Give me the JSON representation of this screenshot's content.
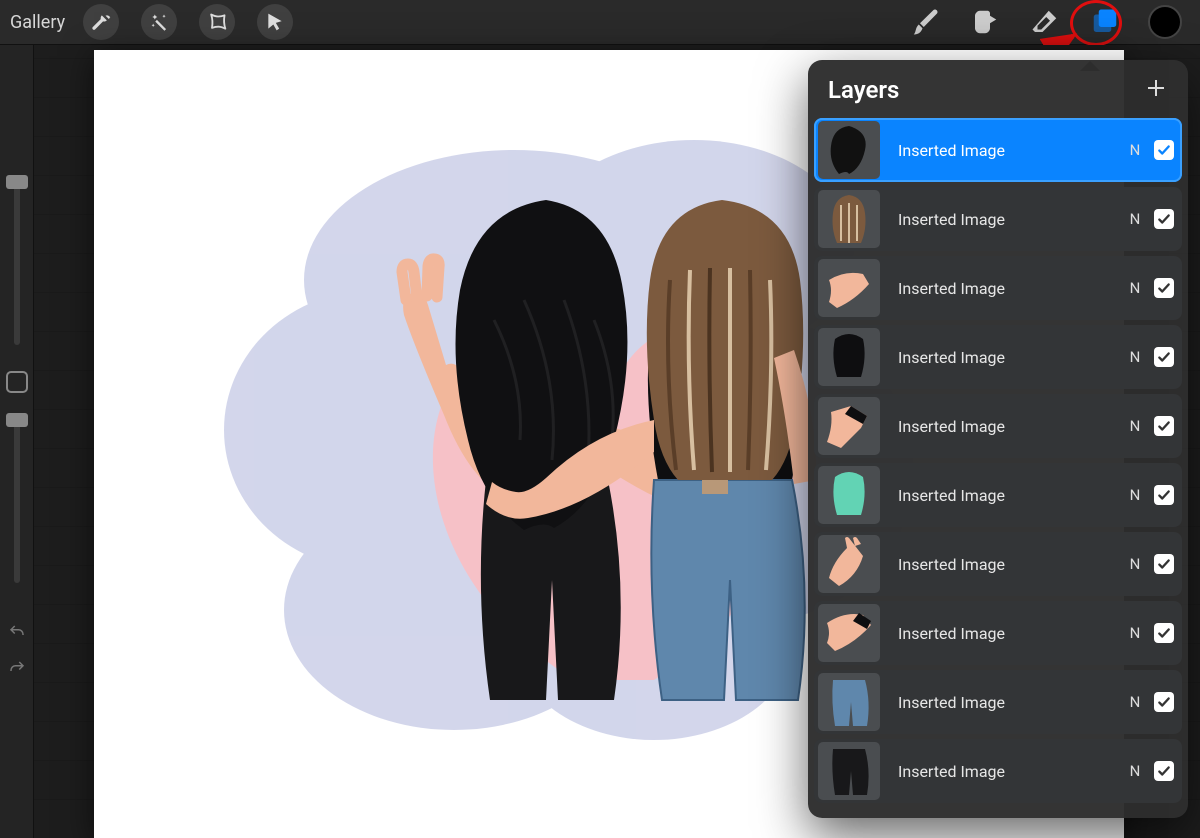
{
  "topbar": {
    "gallery_label": "Gallery",
    "left_tools": [
      {
        "name": "actions-button",
        "icon": "wrench"
      },
      {
        "name": "adjustments-button",
        "icon": "wand"
      },
      {
        "name": "selection-button",
        "icon": "selection"
      },
      {
        "name": "transform-button",
        "icon": "arrow"
      }
    ],
    "right_tools": [
      {
        "name": "brush-tool",
        "icon": "brush",
        "active": false
      },
      {
        "name": "smudge-tool",
        "icon": "smudge",
        "active": false
      },
      {
        "name": "eraser-tool",
        "icon": "eraser",
        "active": false
      },
      {
        "name": "layers-button",
        "icon": "layers",
        "active": true
      },
      {
        "name": "color-swatch",
        "icon": "color",
        "color": "#000000"
      }
    ]
  },
  "annotation": {
    "target": "layers-button",
    "style": "red-circle-with-arrow"
  },
  "layers_panel": {
    "title": "Layers",
    "add_button": "add-layer",
    "layers": [
      {
        "name": "Inserted Image",
        "blend": "N",
        "visible": true,
        "selected": true,
        "thumb": "hair-black"
      },
      {
        "name": "Inserted Image",
        "blend": "N",
        "visible": true,
        "selected": false,
        "thumb": "hair-brown"
      },
      {
        "name": "Inserted Image",
        "blend": "N",
        "visible": true,
        "selected": false,
        "thumb": "arm-skin"
      },
      {
        "name": "Inserted Image",
        "blend": "N",
        "visible": true,
        "selected": false,
        "thumb": "top-black"
      },
      {
        "name": "Inserted Image",
        "blend": "N",
        "visible": true,
        "selected": false,
        "thumb": "arm-black"
      },
      {
        "name": "Inserted Image",
        "blend": "N",
        "visible": true,
        "selected": false,
        "thumb": "top-teal"
      },
      {
        "name": "Inserted Image",
        "blend": "N",
        "visible": true,
        "selected": false,
        "thumb": "arm-peace"
      },
      {
        "name": "Inserted Image",
        "blend": "N",
        "visible": true,
        "selected": false,
        "thumb": "arm-cross"
      },
      {
        "name": "Inserted Image",
        "blend": "N",
        "visible": true,
        "selected": false,
        "thumb": "jeans-blue"
      },
      {
        "name": "Inserted Image",
        "blend": "N",
        "visible": true,
        "selected": false,
        "thumb": "jeans-black"
      }
    ]
  },
  "canvas": {
    "background": "#ffffff",
    "artwork_description": "Two girls from behind, arms around each other, in front of a pink heart with blue watercolor texture"
  }
}
